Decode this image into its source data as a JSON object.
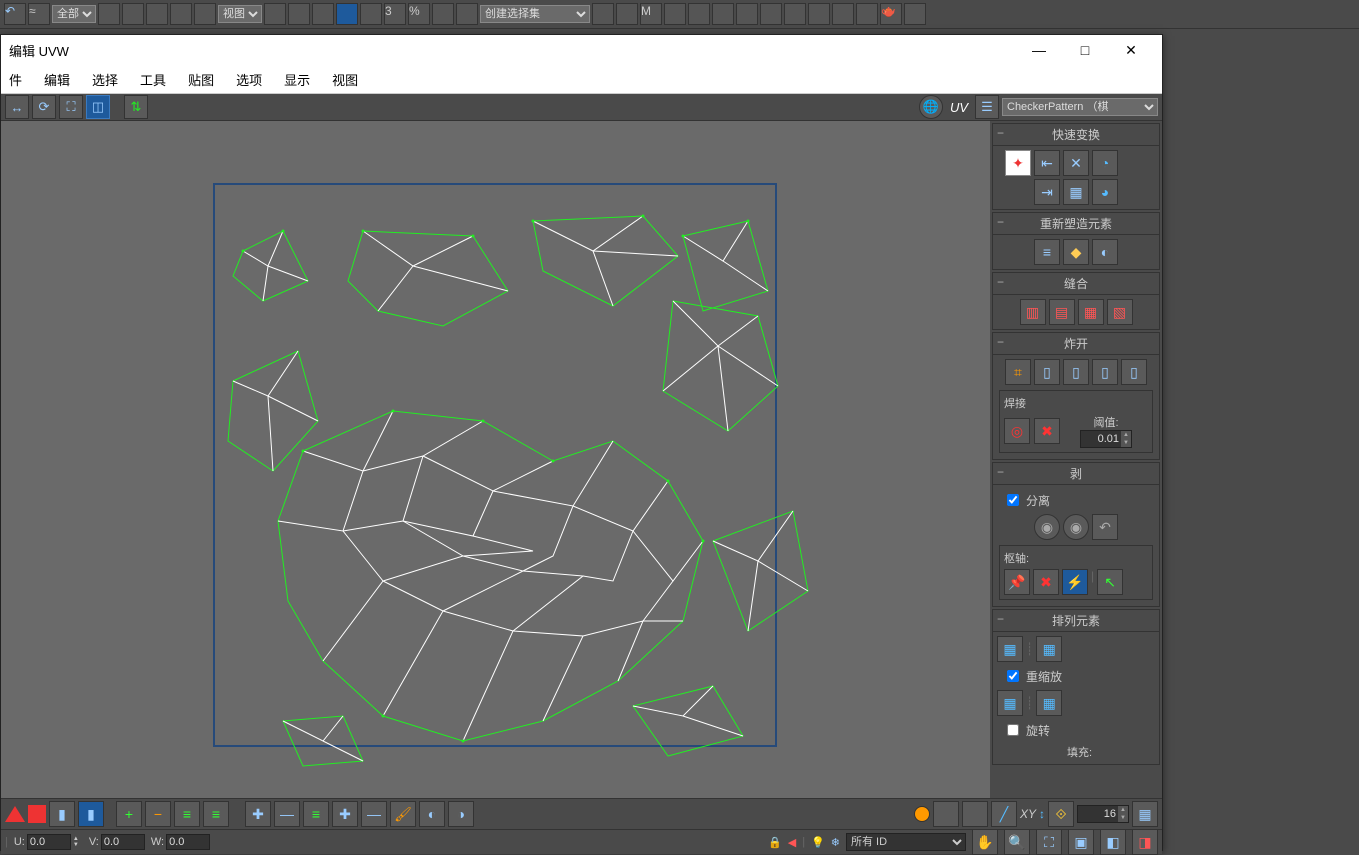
{
  "main_toolbar": {
    "filter_label": "全部",
    "view_label": "视图",
    "selset_label": "创建选择集"
  },
  "uvw": {
    "title": "编辑 UVW",
    "menu": {
      "file": "件",
      "edit": "编辑",
      "select": "选择",
      "tools": "工具",
      "texture": "贴图",
      "options": "选项",
      "display": "显示",
      "view": "视图"
    },
    "uv_label": "UV",
    "checker_label": "CheckerPattern （棋",
    "rollouts": {
      "quick": "快速变换",
      "reshape": "重新塑造元素",
      "stitch": "缝合",
      "explode": "炸开",
      "weld": "焊接",
      "threshold_lbl": "阈值:",
      "threshold_val": "0.01",
      "peel": "剥",
      "detach": "分离",
      "pivot": "枢轴:",
      "arrange": "排列元素",
      "rescale": "重缩放",
      "rotate": "旋转",
      "fill": "填充:"
    },
    "bottom": {
      "xy": "XY",
      "step": "16"
    },
    "status": {
      "u": "U:",
      "v": "V:",
      "w": "W:",
      "uval": "0.0",
      "vval": "0.0",
      "wval": "0.0",
      "id_label": "所有 ID"
    }
  }
}
